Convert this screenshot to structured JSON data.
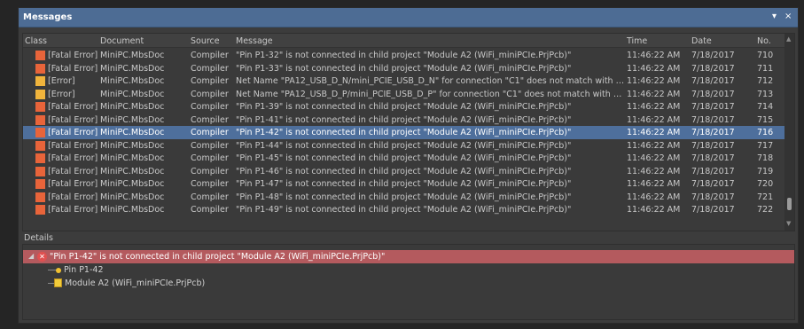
{
  "window": {
    "title": "Messages",
    "menu_glyph": "▾",
    "close_glyph": "×"
  },
  "columns": {
    "class": "Class",
    "document": "Document",
    "source": "Source",
    "message": "Message",
    "time": "Time",
    "date": "Date",
    "no": "No."
  },
  "rows": [
    {
      "cls": "[Fatal Error]",
      "type": "fatal",
      "doc": "MiniPC.MbsDoc",
      "src": "Compiler",
      "msg": "\"Pin P1-32\" is not connected in child project \"Module A2 (WiFi_miniPCIe.PrjPcb)\"",
      "time": "11:46:22 AM",
      "date": "7/18/2017",
      "no": "710"
    },
    {
      "cls": "[Fatal Error]",
      "type": "fatal",
      "doc": "MiniPC.MbsDoc",
      "src": "Compiler",
      "msg": "\"Pin P1-33\" is not connected in child project \"Module A2 (WiFi_miniPCIe.PrjPcb)\"",
      "time": "11:46:22 AM",
      "date": "7/18/2017",
      "no": "711"
    },
    {
      "cls": "[Error]",
      "type": "err",
      "doc": "MiniPC.MbsDoc",
      "src": "Compiler",
      "msg": "Net Name \"PA12_USB_D_N/mini_PCIE_USB_D_N\" for connection \"C1\" does not match with N...",
      "time": "11:46:22 AM",
      "date": "7/18/2017",
      "no": "712"
    },
    {
      "cls": "[Error]",
      "type": "err",
      "doc": "MiniPC.MbsDoc",
      "src": "Compiler",
      "msg": "Net Name \"PA12_USB_D_P/mini_PCIE_USB_D_P\" for connection \"C1\" does not match with Ne...",
      "time": "11:46:22 AM",
      "date": "7/18/2017",
      "no": "713"
    },
    {
      "cls": "[Fatal Error]",
      "type": "fatal",
      "doc": "MiniPC.MbsDoc",
      "src": "Compiler",
      "msg": "\"Pin P1-39\" is not connected in child project \"Module A2 (WiFi_miniPCIe.PrjPcb)\"",
      "time": "11:46:22 AM",
      "date": "7/18/2017",
      "no": "714"
    },
    {
      "cls": "[Fatal Error]",
      "type": "fatal",
      "doc": "MiniPC.MbsDoc",
      "src": "Compiler",
      "msg": "\"Pin P1-41\" is not connected in child project \"Module A2 (WiFi_miniPCIe.PrjPcb)\"",
      "time": "11:46:22 AM",
      "date": "7/18/2017",
      "no": "715"
    },
    {
      "cls": "[Fatal Error]",
      "type": "fatal",
      "doc": "MiniPC.MbsDoc",
      "src": "Compiler",
      "msg": "\"Pin P1-42\" is not connected in child project \"Module A2 (WiFi_miniPCIe.PrjPcb)\"",
      "time": "11:46:22 AM",
      "date": "7/18/2017",
      "no": "716"
    },
    {
      "cls": "[Fatal Error]",
      "type": "fatal",
      "doc": "MiniPC.MbsDoc",
      "src": "Compiler",
      "msg": "\"Pin P1-44\" is not connected in child project \"Module A2 (WiFi_miniPCIe.PrjPcb)\"",
      "time": "11:46:22 AM",
      "date": "7/18/2017",
      "no": "717"
    },
    {
      "cls": "[Fatal Error]",
      "type": "fatal",
      "doc": "MiniPC.MbsDoc",
      "src": "Compiler",
      "msg": "\"Pin P1-45\" is not connected in child project \"Module A2 (WiFi_miniPCIe.PrjPcb)\"",
      "time": "11:46:22 AM",
      "date": "7/18/2017",
      "no": "718"
    },
    {
      "cls": "[Fatal Error]",
      "type": "fatal",
      "doc": "MiniPC.MbsDoc",
      "src": "Compiler",
      "msg": "\"Pin P1-46\" is not connected in child project \"Module A2 (WiFi_miniPCIe.PrjPcb)\"",
      "time": "11:46:22 AM",
      "date": "7/18/2017",
      "no": "719"
    },
    {
      "cls": "[Fatal Error]",
      "type": "fatal",
      "doc": "MiniPC.MbsDoc",
      "src": "Compiler",
      "msg": "\"Pin P1-47\" is not connected in child project \"Module A2 (WiFi_miniPCIe.PrjPcb)\"",
      "time": "11:46:22 AM",
      "date": "7/18/2017",
      "no": "720"
    },
    {
      "cls": "[Fatal Error]",
      "type": "fatal",
      "doc": "MiniPC.MbsDoc",
      "src": "Compiler",
      "msg": "\"Pin P1-48\" is not connected in child project \"Module A2 (WiFi_miniPCIe.PrjPcb)\"",
      "time": "11:46:22 AM",
      "date": "7/18/2017",
      "no": "721"
    },
    {
      "cls": "[Fatal Error]",
      "type": "fatal",
      "doc": "MiniPC.MbsDoc",
      "src": "Compiler",
      "msg": "\"Pin P1-49\" is not connected in child project \"Module A2 (WiFi_miniPCIe.PrjPcb)\"",
      "time": "11:46:22 AM",
      "date": "7/18/2017",
      "no": "722"
    }
  ],
  "selected_row": 6,
  "details": {
    "label": "Details",
    "error_text": "\"Pin P1-42\" is not connected in child project \"Module A2 (WiFi_miniPCIe.PrjPcb)\"",
    "pin": "Pin P1-42",
    "module": "Module A2 (WiFi_miniPCIe.PrjPcb)"
  },
  "colors": {
    "title_bar": "#4d6c94",
    "selection": "#4e6f9c",
    "fatal_icon": "#e8643a",
    "error_icon": "#f0b43c",
    "detail_error_row": "#b45a5e"
  }
}
